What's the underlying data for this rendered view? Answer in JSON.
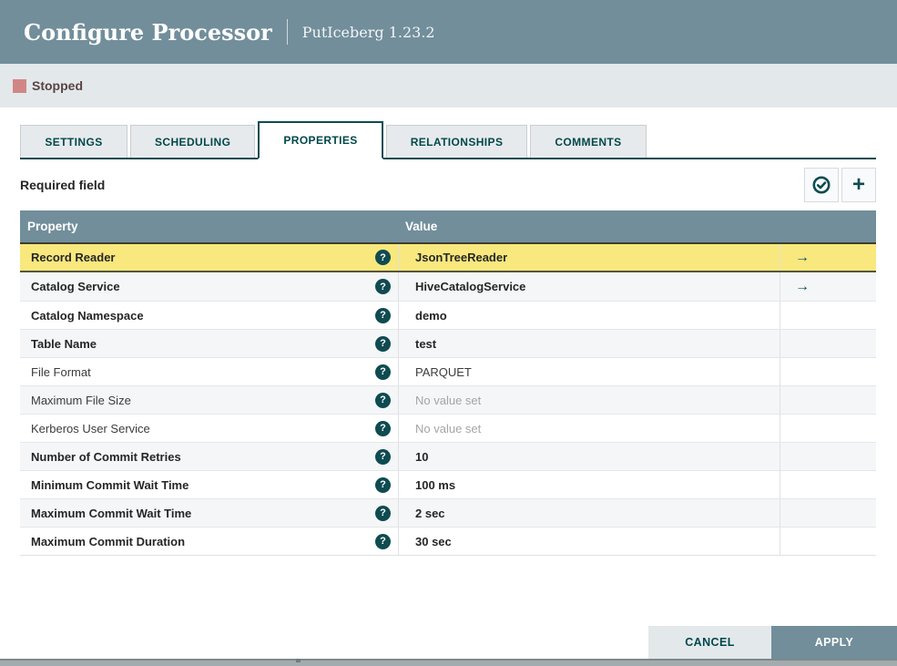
{
  "dialog": {
    "title": "Configure Processor",
    "subtitle": "PutIceberg 1.23.2",
    "status": {
      "label": "Stopped"
    }
  },
  "tabs": [
    {
      "label": "SETTINGS",
      "active": false
    },
    {
      "label": "SCHEDULING",
      "active": false
    },
    {
      "label": "PROPERTIES",
      "active": true
    },
    {
      "label": "RELATIONSHIPS",
      "active": false
    },
    {
      "label": "COMMENTS",
      "active": false
    }
  ],
  "toolbar": {
    "required_field_label": "Required field",
    "icons": [
      "verify-properties-icon",
      "add-property-icon"
    ]
  },
  "icons": {
    "help": "?",
    "link_arrow": "→",
    "add": "+"
  },
  "properties_table": {
    "columns": {
      "property": "Property",
      "value": "Value"
    },
    "rows": [
      {
        "name": "Record Reader",
        "value": "JsonTreeReader",
        "required": true,
        "unset": false,
        "has_link": true,
        "selected": true
      },
      {
        "name": "Catalog Service",
        "value": "HiveCatalogService",
        "required": true,
        "unset": false,
        "has_link": true,
        "selected": false
      },
      {
        "name": "Catalog Namespace",
        "value": "demo",
        "required": true,
        "unset": false,
        "has_link": false,
        "selected": false
      },
      {
        "name": "Table Name",
        "value": "test",
        "required": true,
        "unset": false,
        "has_link": false,
        "selected": false
      },
      {
        "name": "File Format",
        "value": "PARQUET",
        "required": false,
        "unset": false,
        "has_link": false,
        "selected": false
      },
      {
        "name": "Maximum File Size",
        "value": "No value set",
        "required": false,
        "unset": true,
        "has_link": false,
        "selected": false
      },
      {
        "name": "Kerberos User Service",
        "value": "No value set",
        "required": false,
        "unset": true,
        "has_link": false,
        "selected": false
      },
      {
        "name": "Number of Commit Retries",
        "value": "10",
        "required": true,
        "unset": false,
        "has_link": false,
        "selected": false
      },
      {
        "name": "Minimum Commit Wait Time",
        "value": "100 ms",
        "required": true,
        "unset": false,
        "has_link": false,
        "selected": false
      },
      {
        "name": "Maximum Commit Wait Time",
        "value": "2 sec",
        "required": true,
        "unset": false,
        "has_link": false,
        "selected": false
      },
      {
        "name": "Maximum Commit Duration",
        "value": "30 sec",
        "required": true,
        "unset": false,
        "has_link": false,
        "selected": false
      }
    ]
  },
  "footer": {
    "cancel_label": "CANCEL",
    "apply_label": "APPLY"
  },
  "colors": {
    "header_bg": "#728e9b",
    "accent_teal": "#004849",
    "tab_border": "#0f4b51",
    "selected_row": "#f8e87d",
    "row_alt": "#f4f6f7",
    "status_bar_bg": "#e3e8eb",
    "stopped_red": "#d18686",
    "apply_bg": "#728e9b",
    "unset_text": "#a5a5a5"
  }
}
